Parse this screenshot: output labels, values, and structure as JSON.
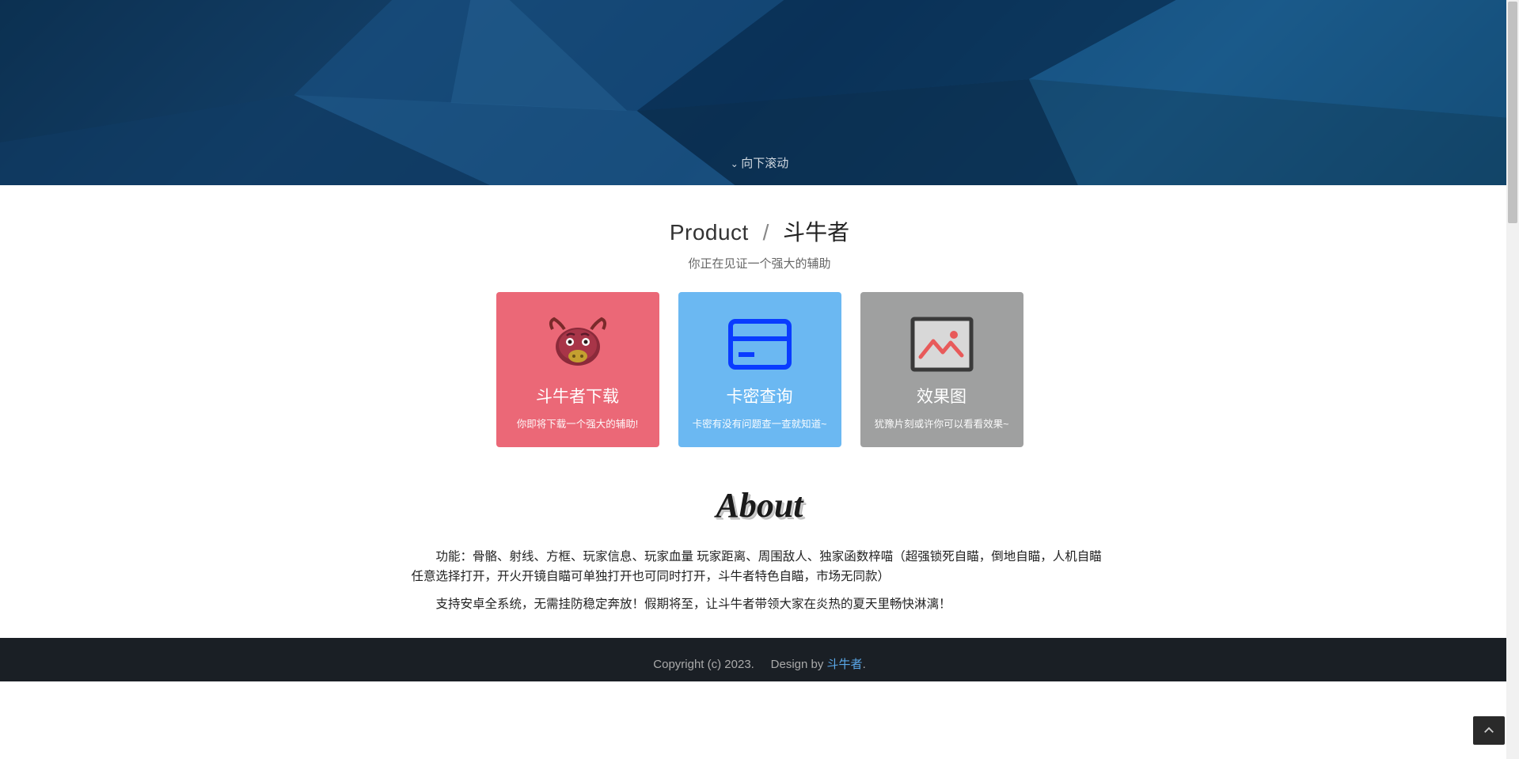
{
  "hero": {
    "scroll_hint": "向下滚动"
  },
  "product": {
    "title_en": "Product",
    "title_sep": "/",
    "title_cn": "斗牛者",
    "subtitle": "你正在见证一个强大的辅助",
    "cards": [
      {
        "title": "斗牛者下载",
        "desc": "你即将下载一个强大的辅助!"
      },
      {
        "title": "卡密查询",
        "desc": "卡密有没有问题查一查就知道~"
      },
      {
        "title": "效果图",
        "desc": "犹豫片刻或许你可以看看效果~"
      }
    ]
  },
  "about": {
    "heading": "About",
    "p1": "功能：骨骼、射线、方框、玩家信息、玩家血量 玩家距离、周围敌人、独家函数梓喵（超强锁死自瞄，倒地自瞄，人机自瞄任意选择打开，开火开镜自瞄可单独打开也可同时打开，斗牛者特色自瞄，市场无同款）",
    "p2": "支持安卓全系统，无需挂防稳定奔放！假期将至，让斗牛者带领大家在炎热的夏天里畅快淋漓！"
  },
  "footer": {
    "copyright": "Copyright (c) 2023.",
    "design_by_label": "Design by ",
    "design_by_link": "斗牛者",
    "period": "."
  }
}
